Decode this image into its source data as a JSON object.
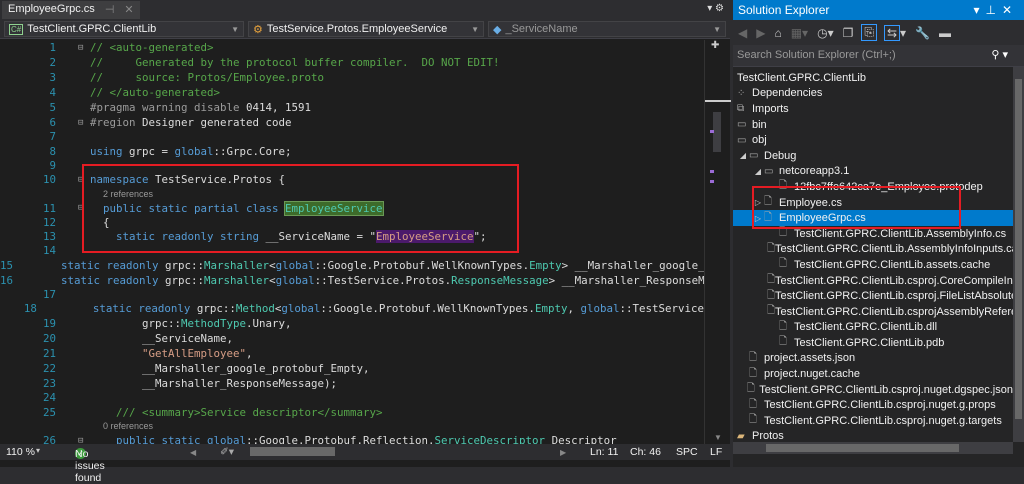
{
  "editor": {
    "tab": {
      "title": "EmployeeGrpc.cs",
      "pin": "⊣",
      "close": "✕"
    },
    "nav": {
      "project": "TestClient.GPRC.ClientLib",
      "type": "TestService.Protos.EmployeeService",
      "member": "_ServiceName"
    },
    "lines": [
      {
        "n": "1",
        "fold": "⊟",
        "seg": [
          [
            "c",
            "// <auto-generated>"
          ]
        ]
      },
      {
        "n": "2",
        "seg": [
          [
            "c",
            "//     Generated by the protocol buffer compiler.  DO NOT EDIT!"
          ]
        ]
      },
      {
        "n": "3",
        "seg": [
          [
            "c",
            "//     source: Protos/Employee.proto"
          ]
        ]
      },
      {
        "n": "4",
        "seg": [
          [
            "c",
            "// </auto-generated>"
          ]
        ]
      },
      {
        "n": "5",
        "seg": [
          [
            "pp",
            "#pragma warning disable "
          ],
          [
            "p",
            "0414, 1591"
          ]
        ]
      },
      {
        "n": "6",
        "fold": "⊟",
        "seg": [
          [
            "pp",
            "#region "
          ],
          [
            "p",
            "Designer generated code"
          ]
        ]
      },
      {
        "n": "7",
        "short": true,
        "seg": []
      },
      {
        "n": "8",
        "seg": [
          [
            "k",
            "using "
          ],
          [
            "p",
            "grpc = "
          ],
          [
            "k",
            "global"
          ],
          [
            "p",
            "::Grpc.Core;"
          ]
        ]
      },
      {
        "n": "9",
        "short": true,
        "seg": []
      },
      {
        "n": "10",
        "fold": "⊟",
        "seg": [
          [
            "k",
            "namespace "
          ],
          [
            "p",
            "TestService.Protos {"
          ]
        ]
      },
      {
        "refs": "2 references"
      },
      {
        "n": "11",
        "fold": "⊟",
        "seg": [
          [
            "k",
            "  public static partial class "
          ],
          [
            "t hl-class",
            "EmployeeService"
          ]
        ]
      },
      {
        "n": "12",
        "short": true,
        "seg": [
          [
            "p",
            "  {"
          ]
        ]
      },
      {
        "n": "13",
        "seg": [
          [
            "k",
            "    static readonly string "
          ],
          [
            "p",
            "__ServiceName = \""
          ],
          [
            "hl-str",
            "EmployeeService"
          ],
          [
            "p",
            "\";"
          ]
        ]
      },
      {
        "n": "14",
        "short": true,
        "seg": []
      },
      {
        "n": "15",
        "seg": [
          [
            "k",
            "    static readonly "
          ],
          [
            "p",
            "grpc::"
          ],
          [
            "t",
            "Marshaller"
          ],
          [
            "p",
            "<"
          ],
          [
            "k",
            "global"
          ],
          [
            "p",
            "::Google.Protobuf.WellKnownTypes."
          ],
          [
            "t",
            "Empty"
          ],
          [
            "p",
            "> __Marshaller_google_protobuf_Empty"
          ]
        ]
      },
      {
        "n": "16",
        "seg": [
          [
            "k",
            "    static readonly "
          ],
          [
            "p",
            "grpc::"
          ],
          [
            "t",
            "Marshaller"
          ],
          [
            "p",
            "<"
          ],
          [
            "k",
            "global"
          ],
          [
            "p",
            "::TestService.Protos."
          ],
          [
            "t",
            "ResponseMessage"
          ],
          [
            "p",
            "> __Marshaller_ResponseMessage"
          ]
        ]
      },
      {
        "n": "17",
        "short": true,
        "seg": []
      },
      {
        "n": "18",
        "seg": [
          [
            "k",
            "    static readonly "
          ],
          [
            "p",
            "grpc::"
          ],
          [
            "t",
            "Method"
          ],
          [
            "p",
            "<"
          ],
          [
            "k",
            "global"
          ],
          [
            "p",
            "::Google.Protobuf.WellKnownTypes."
          ],
          [
            "t",
            "Empty"
          ],
          [
            "p",
            ", "
          ],
          [
            "k",
            "global"
          ],
          [
            "p",
            "::TestService"
          ]
        ]
      },
      {
        "n": "19",
        "seg": [
          [
            "p",
            "        grpc::"
          ],
          [
            "t",
            "MethodType"
          ],
          [
            "p",
            ".Unary,"
          ]
        ]
      },
      {
        "n": "20",
        "seg": [
          [
            "p",
            "        __ServiceName,"
          ]
        ]
      },
      {
        "n": "21",
        "seg": [
          [
            "s",
            "        \"GetAllEmployee\""
          ],
          [
            "p",
            ","
          ]
        ]
      },
      {
        "n": "22",
        "seg": [
          [
            "p",
            "        __Marshaller_google_protobuf_Empty,"
          ]
        ]
      },
      {
        "n": "23",
        "seg": [
          [
            "p",
            "        __Marshaller_ResponseMessage);"
          ]
        ]
      },
      {
        "n": "24",
        "short": true,
        "seg": []
      },
      {
        "n": "25",
        "seg": [
          [
            "c",
            "    /// <summary>Service descriptor</summary>"
          ]
        ]
      },
      {
        "refs": "0 references"
      },
      {
        "n": "26",
        "fold": "⊟",
        "seg": [
          [
            "k",
            "    public static "
          ],
          [
            "k",
            "global"
          ],
          [
            "p",
            "::Google.Protobuf.Reflection."
          ],
          [
            "t",
            "ServiceDescriptor"
          ],
          [
            "p",
            " Descriptor"
          ]
        ]
      }
    ]
  },
  "status": {
    "zoom": "110 %",
    "issues": "No issues found",
    "line": "Ln: 11",
    "col": "Ch: 46",
    "spacing": "SPC",
    "eol": "LF"
  },
  "solution_explorer": {
    "title": "Solution Explorer",
    "search_placeholder": "Search Solution Explorer (Ctrl+;)",
    "items": [
      {
        "label": "TestClient.GPRC.ClientLib",
        "level": 0,
        "arrow": "",
        "icon": ""
      },
      {
        "label": "Dependencies",
        "level": 0,
        "arrow": "",
        "icon": "dependencies-icon"
      },
      {
        "label": "Imports",
        "level": 0,
        "arrow": "",
        "icon": "imports-icon"
      },
      {
        "label": "bin",
        "level": 0,
        "arrow": "",
        "icon": "folder-icon"
      },
      {
        "label": "obj",
        "level": 0,
        "arrow": "",
        "icon": "folder-icon"
      },
      {
        "label": "Debug",
        "level": 1,
        "arrow": "◢",
        "icon": "folder-icon"
      },
      {
        "label": "netcoreapp3.1",
        "level": 2,
        "arrow": "◢",
        "icon": "folder-icon"
      },
      {
        "label": "12fbc7ffe642ca7e_Employee.protodep",
        "level": 3,
        "arrow": "",
        "icon": "file-icon"
      },
      {
        "label": "Employee.cs",
        "level": 2,
        "arrow": "▷",
        "icon": "file-icon"
      },
      {
        "label": "EmployeeGrpc.cs",
        "level": 2,
        "arrow": "▷",
        "icon": "file-icon",
        "selected": true
      },
      {
        "label": "TestClient.GPRC.ClientLib.AssemblyInfo.cs",
        "level": 3,
        "arrow": "",
        "icon": "file-icon"
      },
      {
        "label": "TestClient.GPRC.ClientLib.AssemblyInfoInputs.cache",
        "level": 3,
        "arrow": "",
        "icon": "file-icon"
      },
      {
        "label": "TestClient.GPRC.ClientLib.assets.cache",
        "level": 3,
        "arrow": "",
        "icon": "file-icon"
      },
      {
        "label": "TestClient.GPRC.ClientLib.csproj.CoreCompileInputs.cache",
        "level": 3,
        "arrow": "",
        "icon": "file-icon"
      },
      {
        "label": "TestClient.GPRC.ClientLib.csproj.FileListAbsolute.txt",
        "level": 3,
        "arrow": "",
        "icon": "file-icon"
      },
      {
        "label": "TestClient.GPRC.ClientLib.csprojAssemblyReference.cache",
        "level": 3,
        "arrow": "",
        "icon": "file-icon"
      },
      {
        "label": "TestClient.GPRC.ClientLib.dll",
        "level": 3,
        "arrow": "",
        "icon": "file-icon"
      },
      {
        "label": "TestClient.GPRC.ClientLib.pdb",
        "level": 3,
        "arrow": "",
        "icon": "file-icon"
      },
      {
        "label": "project.assets.json",
        "level": 1,
        "arrow": "",
        "icon": "file-icon"
      },
      {
        "label": "project.nuget.cache",
        "level": 1,
        "arrow": "",
        "icon": "file-icon"
      },
      {
        "label": "TestClient.GPRC.ClientLib.csproj.nuget.dgspec.json",
        "level": 1,
        "arrow": "",
        "icon": "file-icon"
      },
      {
        "label": "TestClient.GPRC.ClientLib.csproj.nuget.g.props",
        "level": 1,
        "arrow": "",
        "icon": "file-icon"
      },
      {
        "label": "TestClient.GPRC.ClientLib.csproj.nuget.g.targets",
        "level": 1,
        "arrow": "",
        "icon": "file-icon"
      },
      {
        "label": "Protos",
        "level": 0,
        "arrow": "",
        "icon": "folder-open-icon"
      }
    ]
  },
  "colors": {
    "accent": "#007acc",
    "highlight_box": "#e51c23"
  }
}
